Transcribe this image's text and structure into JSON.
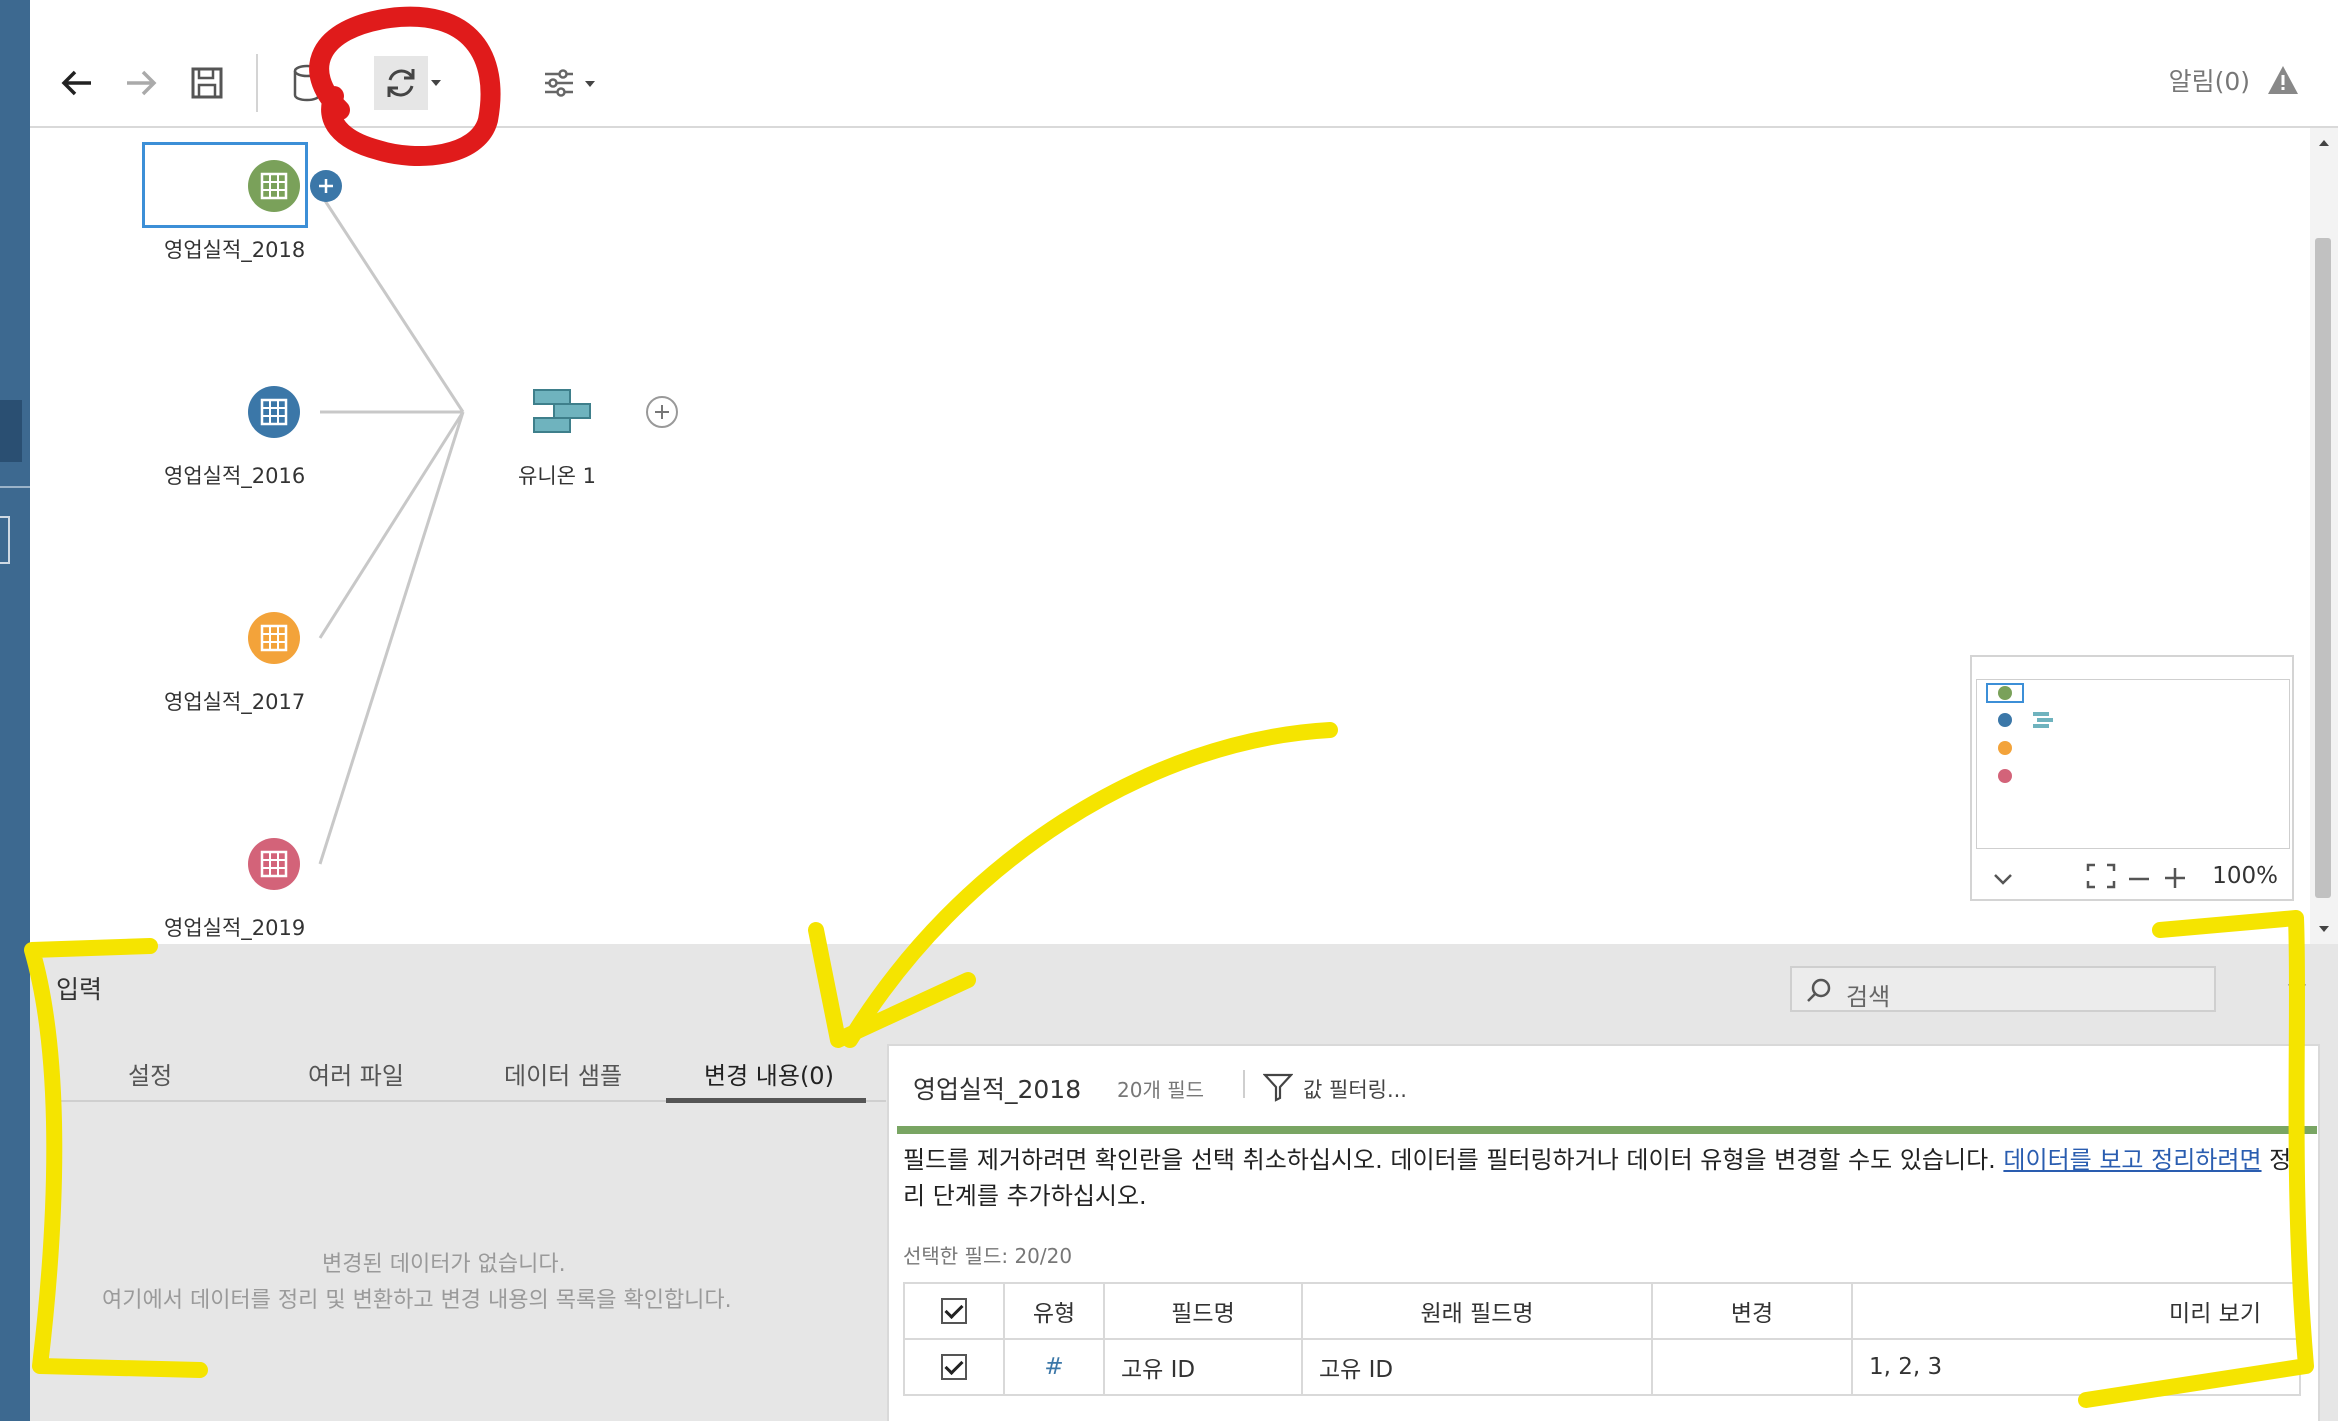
{
  "toolbar": {
    "alerts_label": "알림(0)"
  },
  "flow": {
    "inputs": [
      {
        "label": "영업실적_2018",
        "color": "#7aa15a",
        "selected": true
      },
      {
        "label": "영업실적_2016",
        "color": "#3b77a8",
        "selected": false
      },
      {
        "label": "영업실적_2017",
        "color": "#f3a33a",
        "selected": false
      },
      {
        "label": "영업실적_2019",
        "color": "#d36379",
        "selected": false
      }
    ],
    "union": {
      "label": "유니온 1",
      "color": "#6fb3be"
    }
  },
  "minimap": {
    "zoom_label": "100%"
  },
  "input_panel": {
    "title": "입력",
    "search_placeholder": "검색",
    "tabs": [
      {
        "label": "설정"
      },
      {
        "label": "여러 파일"
      },
      {
        "label": "데이터 샘플"
      },
      {
        "label": "변경 내용(0)",
        "active": true
      }
    ],
    "empty_line1": "변경된 데이터가 없습니다.",
    "empty_line2": "여기에서 데이터를 정리 및 변환하고 변경 내용의 목록을 확인합니다."
  },
  "field_panel": {
    "title": "영업실적_2018",
    "field_count": "20개 필드",
    "filter_label": "값 필터링...",
    "instruction_text": "필드를 제거하려면 확인란을 선택 취소하십시오. 데이터를 필터링하거나 데이터 유형을 변경할 수도 있습니다. ",
    "instruction_link": "데이터를 보고 정리하려면",
    "instruction_suffix": " 정리 단계를 추가하십시오.",
    "selected_fields": "선택한 필드: 20/20",
    "columns": [
      "유형",
      "필드명",
      "원래 필드명",
      "변경",
      "미리 보기"
    ],
    "rows": [
      {
        "type_icon": "#",
        "field_name": "고유 ID",
        "original_name": "고유 ID",
        "change": "",
        "preview": "1, 2, 3"
      }
    ]
  },
  "colors": {
    "sidebar": "#3d6990",
    "annotation_red": "#e01b1b",
    "annotation_yellow": "#f5e400",
    "link_green": "#79a563"
  }
}
